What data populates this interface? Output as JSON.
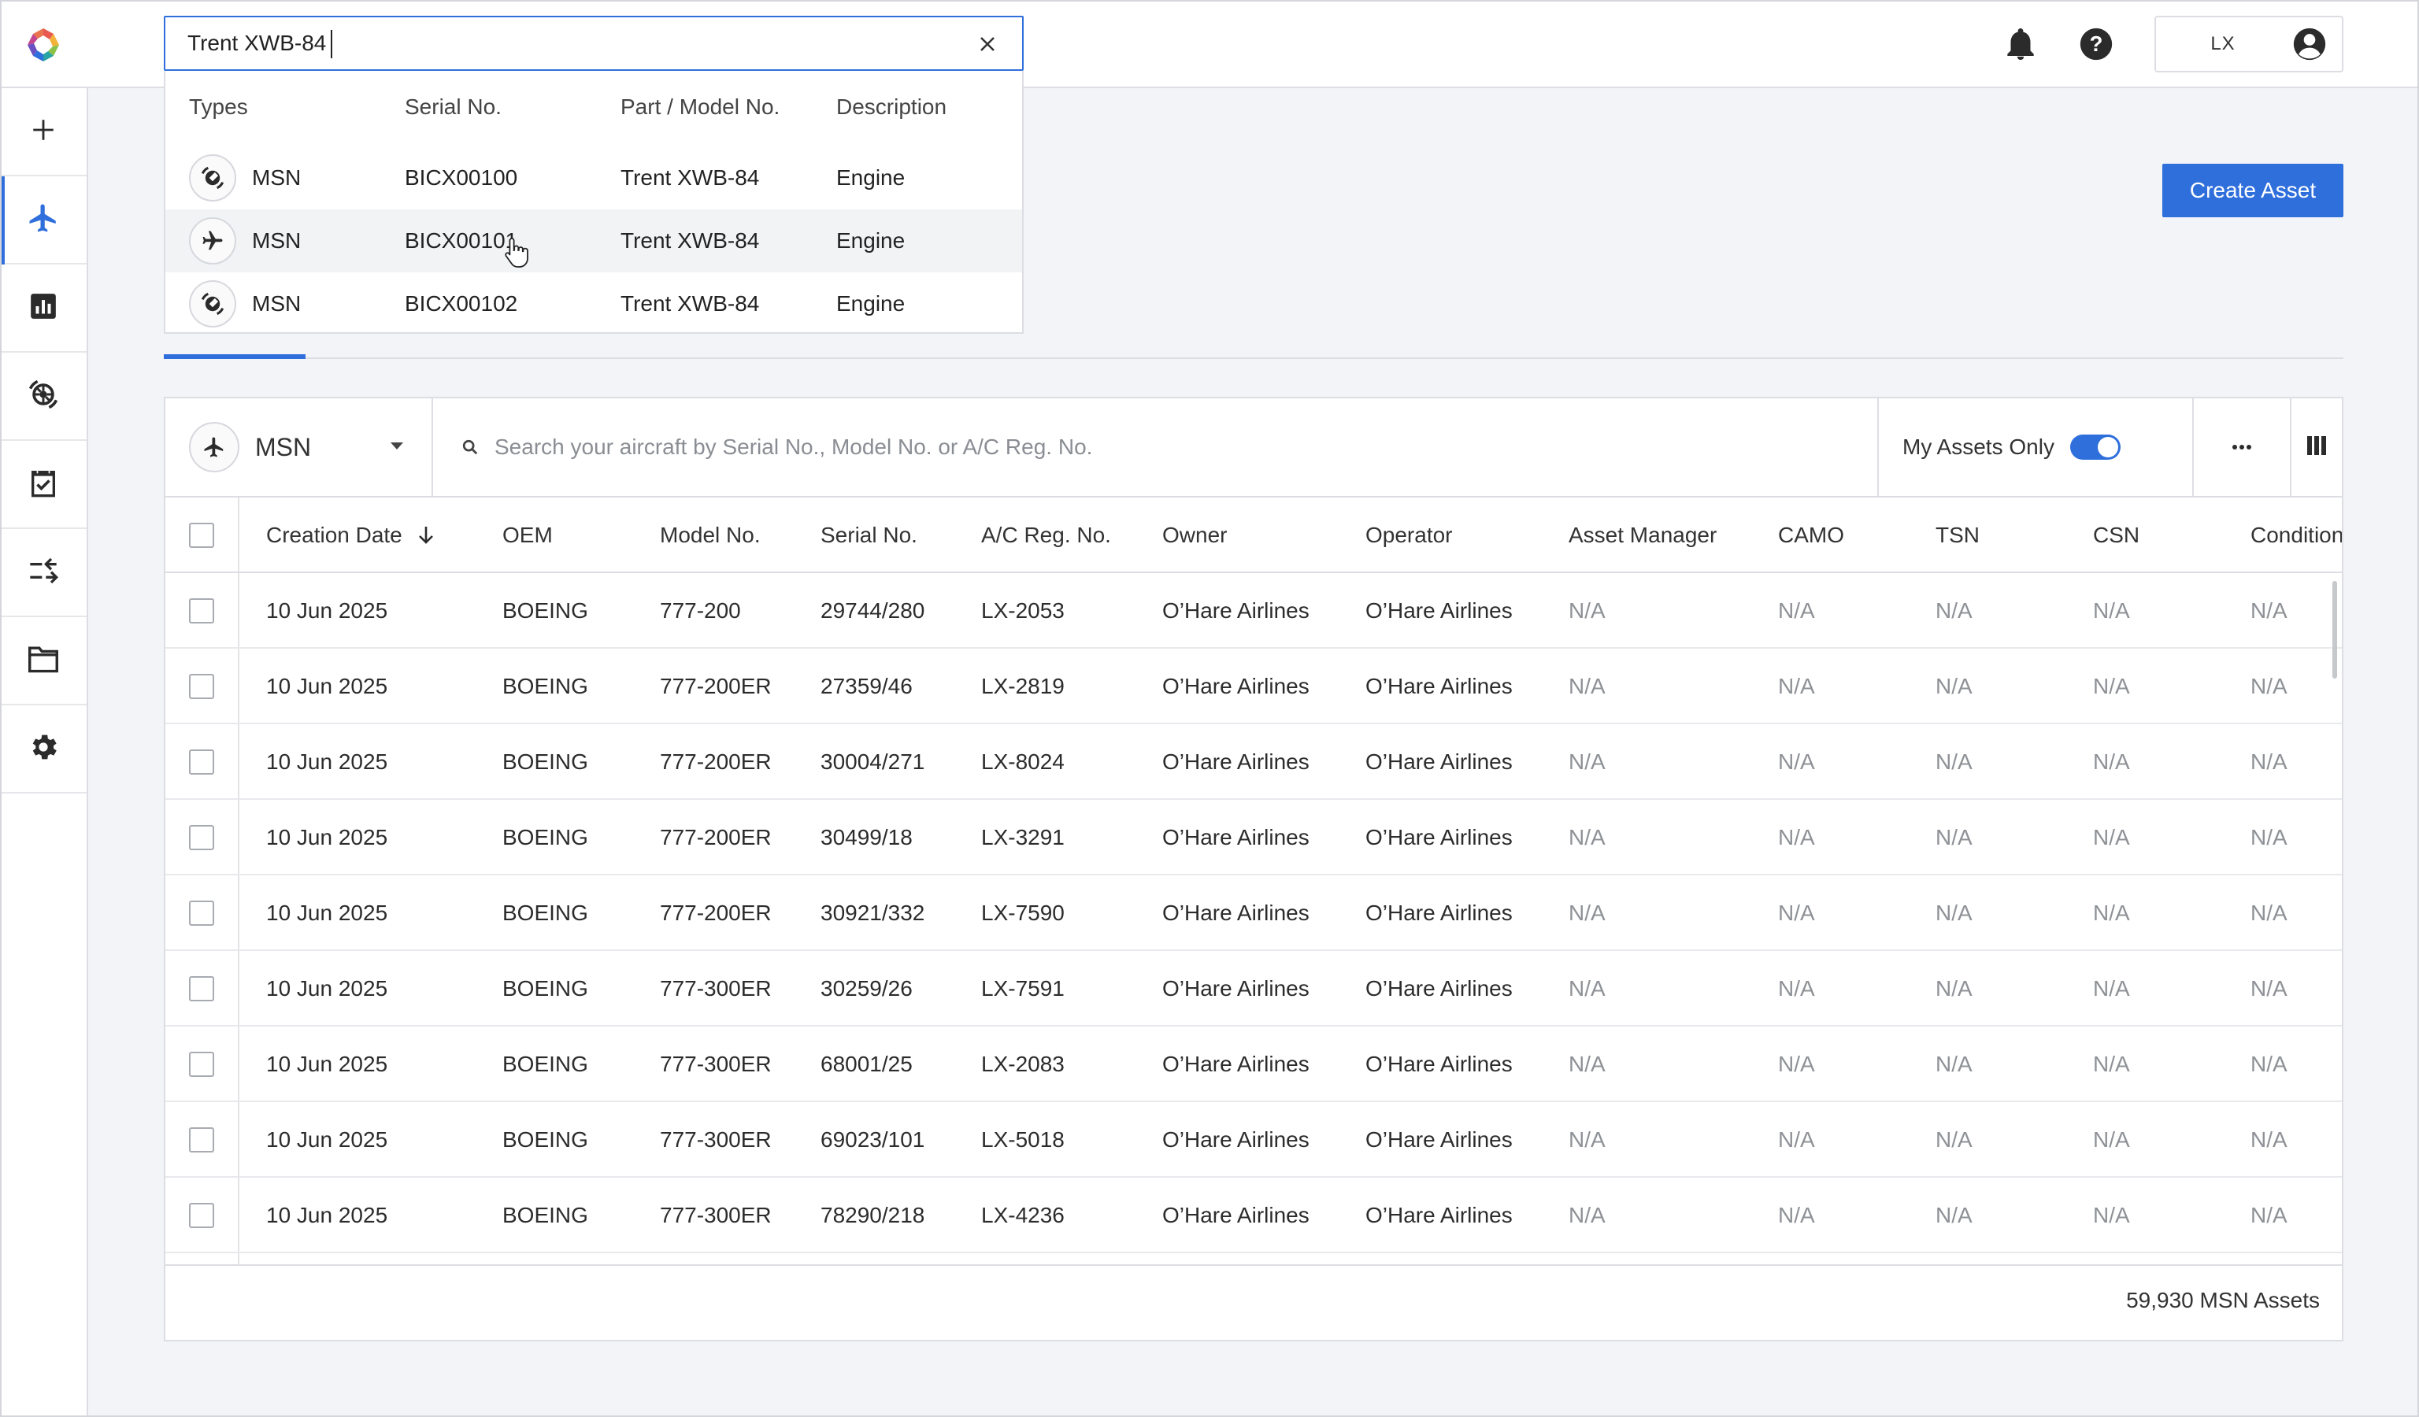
{
  "header": {
    "user_initials": "LX",
    "icons": [
      "bell-icon",
      "help-icon",
      "account-icon"
    ]
  },
  "global_search": {
    "value": "Trent XWB-84",
    "columns": [
      "Types",
      "Serial No.",
      "Part / Model No.",
      "Description"
    ],
    "results": [
      {
        "type_icon": "engine-icon",
        "type": "MSN",
        "serial": "BICX00100",
        "model": "Trent XWB-84",
        "description": "Engine"
      },
      {
        "type_icon": "airplane-icon",
        "type": "MSN",
        "serial": "BICX00101",
        "model": "Trent XWB-84",
        "description": "Engine"
      },
      {
        "type_icon": "engine-icon",
        "type": "MSN",
        "serial": "BICX00102",
        "model": "Trent XWB-84",
        "description": "Engine"
      }
    ]
  },
  "sidebar": {
    "items": [
      {
        "name": "add",
        "icon": "plus-icon"
      },
      {
        "name": "aircraft",
        "icon": "airplane-icon",
        "active": true
      },
      {
        "name": "reports",
        "icon": "chart-icon"
      },
      {
        "name": "engines",
        "icon": "engine-icon"
      },
      {
        "name": "tasks",
        "icon": "clipboard-check-icon"
      },
      {
        "name": "transfers",
        "icon": "transfer-icon"
      },
      {
        "name": "documents",
        "icon": "folder-icon"
      },
      {
        "name": "settings",
        "icon": "gear-icon"
      }
    ]
  },
  "actions": {
    "create_asset": "Create Asset"
  },
  "toolbar": {
    "asset_type": "MSN",
    "search_placeholder": "Search your aircraft by Serial No., Model No. or A/C Reg. No.",
    "my_assets_label": "My Assets Only",
    "my_assets_on": true,
    "more_label": "···"
  },
  "table": {
    "columns": [
      "Creation Date",
      "OEM",
      "Model No.",
      "Serial No.",
      "A/C Reg. No.",
      "Owner",
      "Operator",
      "Asset Manager",
      "CAMO",
      "TSN",
      "CSN",
      "Condition"
    ],
    "sort": {
      "column": "Creation Date",
      "direction": "desc"
    },
    "rows": [
      {
        "date": "10 Jun 2025",
        "oem": "BOEING",
        "model": "777-200",
        "serial": "29744/280",
        "reg": "LX-2053",
        "owner": "O’Hare Airlines",
        "operator": "O’Hare Airlines",
        "manager": "N/A",
        "camo": "N/A",
        "tsn": "N/A",
        "csn": "N/A",
        "condition": "N/A"
      },
      {
        "date": "10 Jun 2025",
        "oem": "BOEING",
        "model": "777-200ER",
        "serial": "27359/46",
        "reg": "LX-2819",
        "owner": "O’Hare Airlines",
        "operator": "O’Hare Airlines",
        "manager": "N/A",
        "camo": "N/A",
        "tsn": "N/A",
        "csn": "N/A",
        "condition": "N/A"
      },
      {
        "date": "10 Jun 2025",
        "oem": "BOEING",
        "model": "777-200ER",
        "serial": "30004/271",
        "reg": "LX-8024",
        "owner": "O’Hare Airlines",
        "operator": "O’Hare Airlines",
        "manager": "N/A",
        "camo": "N/A",
        "tsn": "N/A",
        "csn": "N/A",
        "condition": "N/A"
      },
      {
        "date": "10 Jun 2025",
        "oem": "BOEING",
        "model": "777-200ER",
        "serial": "30499/18",
        "reg": "LX-3291",
        "owner": "O’Hare Airlines",
        "operator": "O’Hare Airlines",
        "manager": "N/A",
        "camo": "N/A",
        "tsn": "N/A",
        "csn": "N/A",
        "condition": "N/A"
      },
      {
        "date": "10 Jun 2025",
        "oem": "BOEING",
        "model": "777-200ER",
        "serial": "30921/332",
        "reg": "LX-7590",
        "owner": "O’Hare Airlines",
        "operator": "O’Hare Airlines",
        "manager": "N/A",
        "camo": "N/A",
        "tsn": "N/A",
        "csn": "N/A",
        "condition": "N/A"
      },
      {
        "date": "10 Jun 2025",
        "oem": "BOEING",
        "model": "777-300ER",
        "serial": "30259/26",
        "reg": "LX-7591",
        "owner": "O’Hare Airlines",
        "operator": "O’Hare Airlines",
        "manager": "N/A",
        "camo": "N/A",
        "tsn": "N/A",
        "csn": "N/A",
        "condition": "N/A"
      },
      {
        "date": "10 Jun 2025",
        "oem": "BOEING",
        "model": "777-300ER",
        "serial": "68001/25",
        "reg": "LX-2083",
        "owner": "O’Hare Airlines",
        "operator": "O’Hare Airlines",
        "manager": "N/A",
        "camo": "N/A",
        "tsn": "N/A",
        "csn": "N/A",
        "condition": "N/A"
      },
      {
        "date": "10 Jun 2025",
        "oem": "BOEING",
        "model": "777-300ER",
        "serial": "69023/101",
        "reg": "LX-5018",
        "owner": "O’Hare Airlines",
        "operator": "O’Hare Airlines",
        "manager": "N/A",
        "camo": "N/A",
        "tsn": "N/A",
        "csn": "N/A",
        "condition": "N/A"
      },
      {
        "date": "10 Jun 2025",
        "oem": "BOEING",
        "model": "777-300ER",
        "serial": "78290/218",
        "reg": "LX-4236",
        "owner": "O’Hare Airlines",
        "operator": "O’Hare Airlines",
        "manager": "N/A",
        "camo": "N/A",
        "tsn": "N/A",
        "csn": "N/A",
        "condition": "N/A"
      }
    ],
    "footer_count": "59,930 MSN Assets"
  },
  "colors": {
    "accent": "#2f6fdc",
    "border": "#dcdee3",
    "muted_text": "#8e9196",
    "background": "#f3f4f8"
  }
}
